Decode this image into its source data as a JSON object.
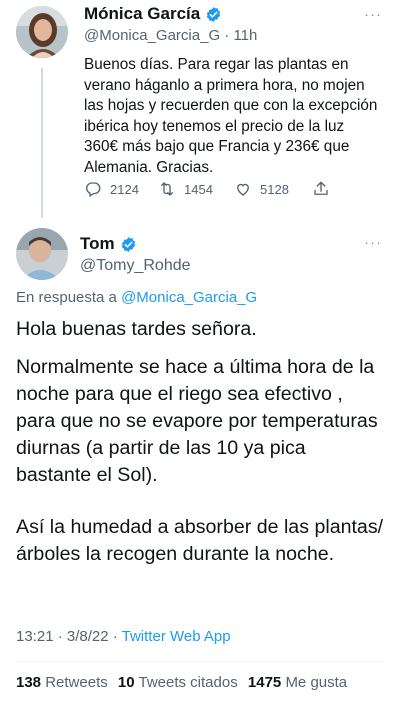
{
  "colors": {
    "accent": "#1d9bf0",
    "text": "#0f1419",
    "secondary": "#536471",
    "line": "#cfd9de"
  },
  "tweet1": {
    "name": "Mónica García",
    "handle": "@Monica_Garcia_G · 11h",
    "text": "Buenos días. Para regar las plantas en verano háganlo a primera hora, no mojen las hojas y recuerden que con la excepción ibérica hoy tenemos el precio de la luz 360€ más bajo que Francia y 236€ que Alemania. Gracias.",
    "replies": "2124",
    "retweets": "1454",
    "likes": "5128",
    "more": "···"
  },
  "tweet2": {
    "name": "Tom",
    "handle": "@Tomy_Rohde",
    "reply_prefix": "En respuesta a ",
    "reply_mention": "@Monica_Garcia_G",
    "paragraphs": [
      "Hola buenas tardes señora.",
      "Normalmente se hace a última hora de la noche para que el riego sea efectivo , para que no se evapore por temperaturas diurnas (a partir de las 10  ya pica bastante el Sol).",
      "Así la humedad a absorber de las plantas/árboles la recogen durante la noche."
    ],
    "time": "13:21 · 3/8/22 · ",
    "app": "Twitter Web App",
    "stats": {
      "retweets_count": "138",
      "retweets_label": "Retweets",
      "quotes_count": "10",
      "quotes_label": "Tweets citados",
      "likes_count": "1475",
      "likes_label": "Me gusta"
    }
  }
}
